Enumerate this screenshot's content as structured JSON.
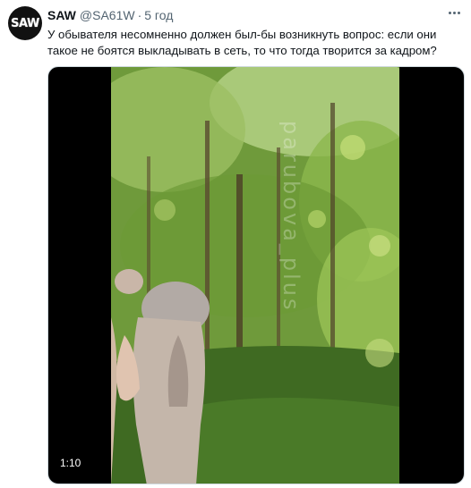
{
  "tweet": {
    "avatar_text": "SAW",
    "display_name": "SAW",
    "handle": "@SA61W",
    "separator": "·",
    "time": "5 год",
    "text": "У обывателя несомненно должен был-бы возникнуть вопрос: если они такое не боятся выкладывать в сеть, то  что тогда творится за кадром?",
    "more_icon": "more-horizontal-icon"
  },
  "media": {
    "type": "video",
    "duration": "1:10",
    "watermark": "parubova_plus",
    "colors": {
      "letterbox": "#000000",
      "foliage": "#5b8a2d",
      "foliage_light": "#a9c77a"
    }
  }
}
